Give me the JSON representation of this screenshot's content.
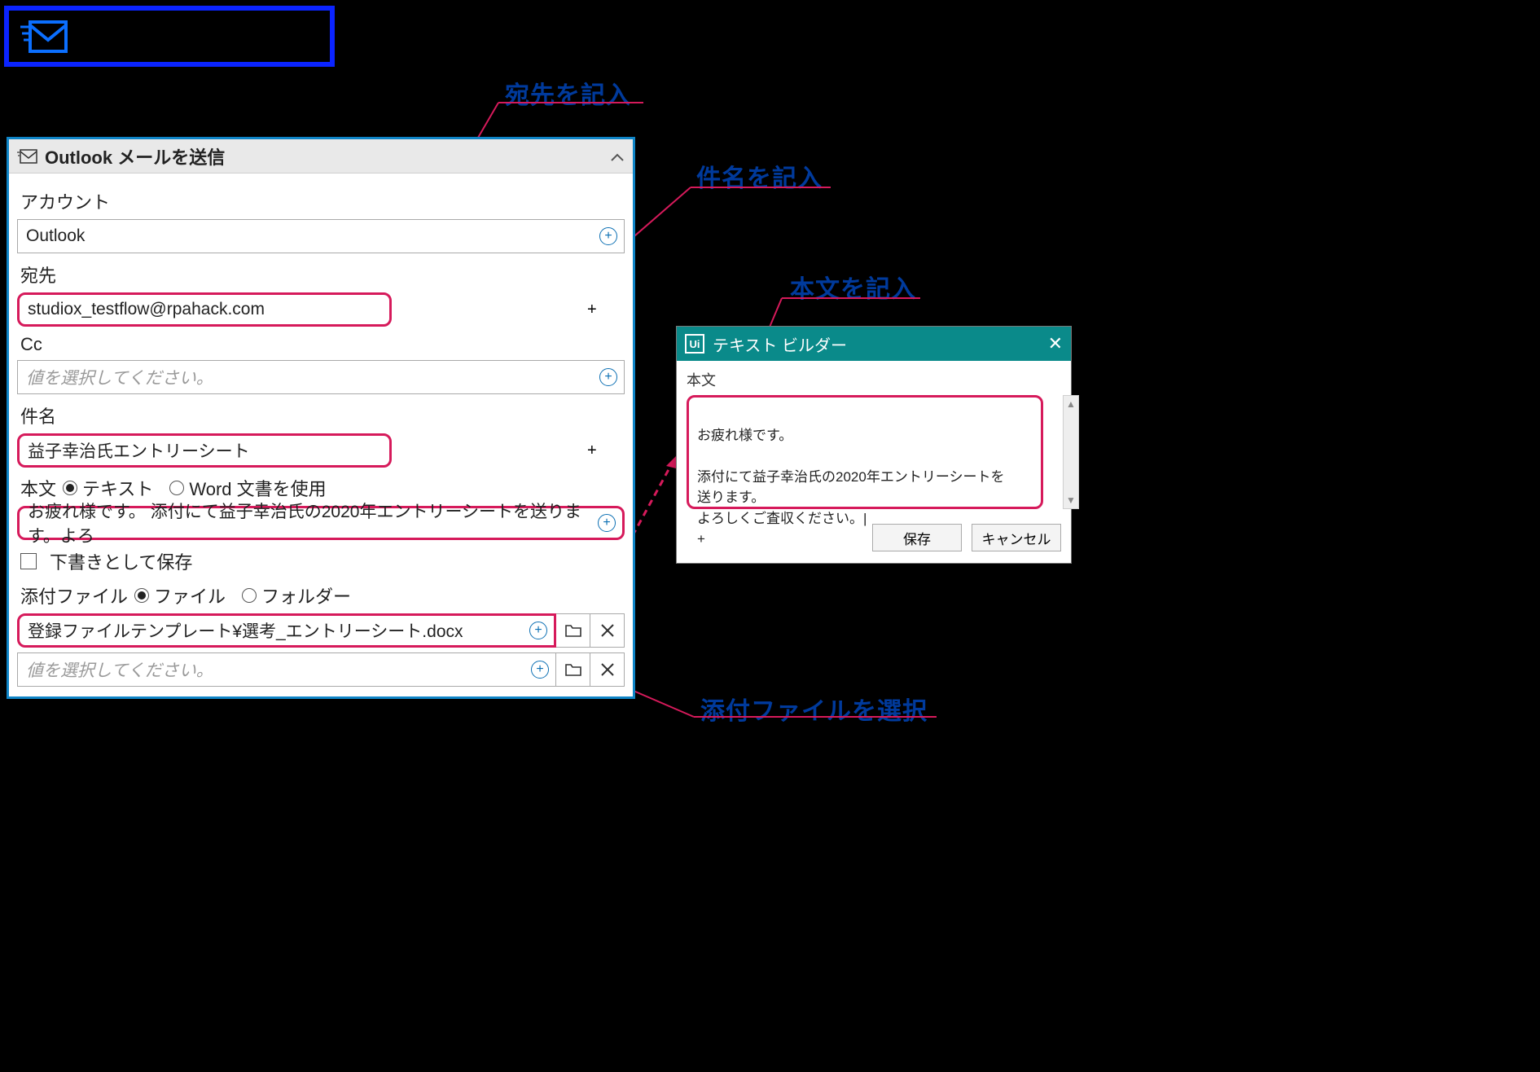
{
  "badge": {
    "icon_name": "send-mail-icon"
  },
  "card": {
    "title": "Outlook メールを送信",
    "account_label": "アカウント",
    "account_value": "Outlook",
    "to_label": "宛先",
    "to_value": "studiox_testflow@rpahack.com",
    "cc_label": "Cc",
    "cc_placeholder": "値を選択してください。",
    "subject_label": "件名",
    "subject_value": "益子幸治氏エントリーシート",
    "body_label": "本文",
    "body_radio_text": "テキスト",
    "body_radio_word": "Word 文書を使用",
    "body_value": "お疲れ様です。 添付にて益子幸治氏の2020年エントリーシートを送ります。よろ",
    "draft_label": "下書きとして保存",
    "attach_label": "添付ファイル",
    "attach_radio_file": "ファイル",
    "attach_radio_folder": "フォルダー",
    "attach_value": "登録ファイルテンプレート¥選考_エントリーシート.docx",
    "attach_placeholder": "値を選択してください。"
  },
  "annotations": {
    "to": "宛先を記入",
    "subject": "件名を記入",
    "body": "本文を記入",
    "attach": "添付ファイルを選択"
  },
  "dialog": {
    "title": "テキスト ビルダー",
    "field_label": "本文",
    "text": "お疲れ様です。\n\n添付にて益子幸治氏の2020年エントリーシートを送ります。\nよろしくご査収ください。|",
    "save": "保存",
    "cancel": "キャンセル"
  },
  "colors": {
    "highlight": "#d61a5b",
    "anno": "#003a9c",
    "accent": "#0f85c7",
    "teal": "#0a8a8a"
  }
}
